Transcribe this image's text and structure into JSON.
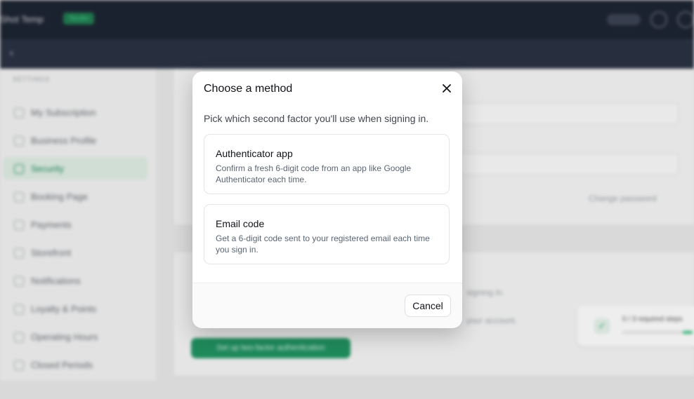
{
  "background": {
    "brand": "Shot Temp",
    "badge": "Studio",
    "sidebar": {
      "heading": "SETTINGS",
      "items": [
        {
          "label": "My Subscription"
        },
        {
          "label": "Business Profile"
        },
        {
          "label": "Security"
        },
        {
          "label": "Booking Page"
        },
        {
          "label": "Payments"
        },
        {
          "label": "Storefront"
        },
        {
          "label": "Notifications"
        },
        {
          "label": "Loyalty & Points"
        },
        {
          "label": "Operating Hours"
        },
        {
          "label": "Closed Periods"
        }
      ]
    },
    "change_password": "Change password",
    "signing_in_text": "signing in.",
    "account_text": "your account.",
    "setup_button": "Set up two-factor authentication",
    "mini_card_text": "0 / 3 required steps"
  },
  "modal": {
    "title": "Choose a method",
    "description": "Pick which second factor you'll use when signing in.",
    "options": [
      {
        "title": "Authenticator app",
        "description": "Confirm a fresh 6-digit code from an app like Google Authenticator each time."
      },
      {
        "title": "Email code",
        "description": "Get a 6-digit code sent to your registered email each time you sign in."
      }
    ],
    "cancel_label": "Cancel",
    "close_icon": "close-icon"
  },
  "colors": {
    "accent": "#1f9361",
    "topbar": "#1b2230"
  }
}
